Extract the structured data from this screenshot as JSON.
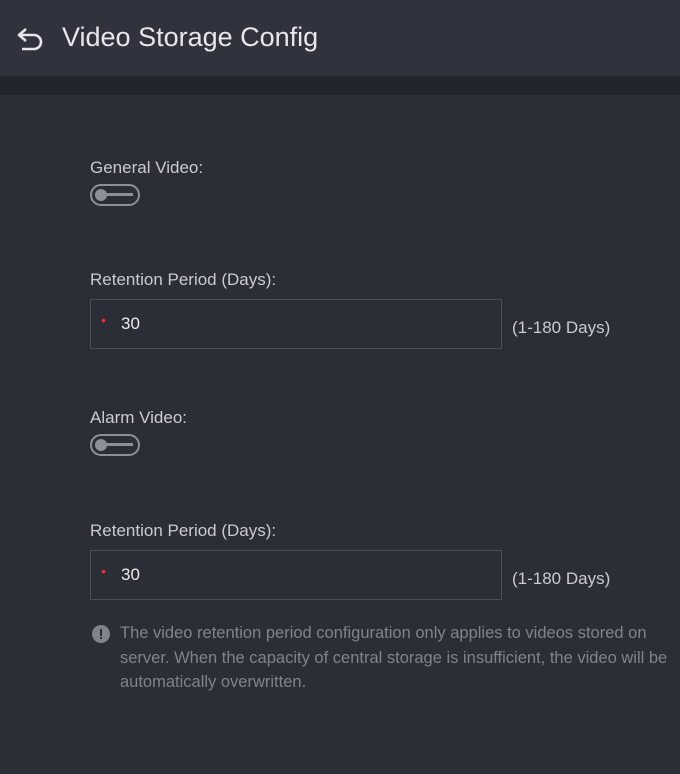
{
  "header": {
    "title": "Video Storage Config",
    "back_icon": "back-arrow-icon"
  },
  "general_video": {
    "label": "General Video:",
    "enabled": false,
    "retention_label": "Retention Period (Days):",
    "retention_value": "30",
    "retention_hint": "(1-180 Days)"
  },
  "alarm_video": {
    "label": "Alarm Video:",
    "enabled": false,
    "retention_label": "Retention Period (Days):",
    "retention_value": "30",
    "retention_hint": "(1-180 Days)"
  },
  "note": {
    "icon": "info-icon",
    "text": "The video retention period configuration only applies to videos stored on server. When the capacity of central storage is insufficient, the video will be automatically overwritten."
  },
  "colors": {
    "background": "#2b2e37",
    "header": "#30333d",
    "required": "#e0352b"
  }
}
